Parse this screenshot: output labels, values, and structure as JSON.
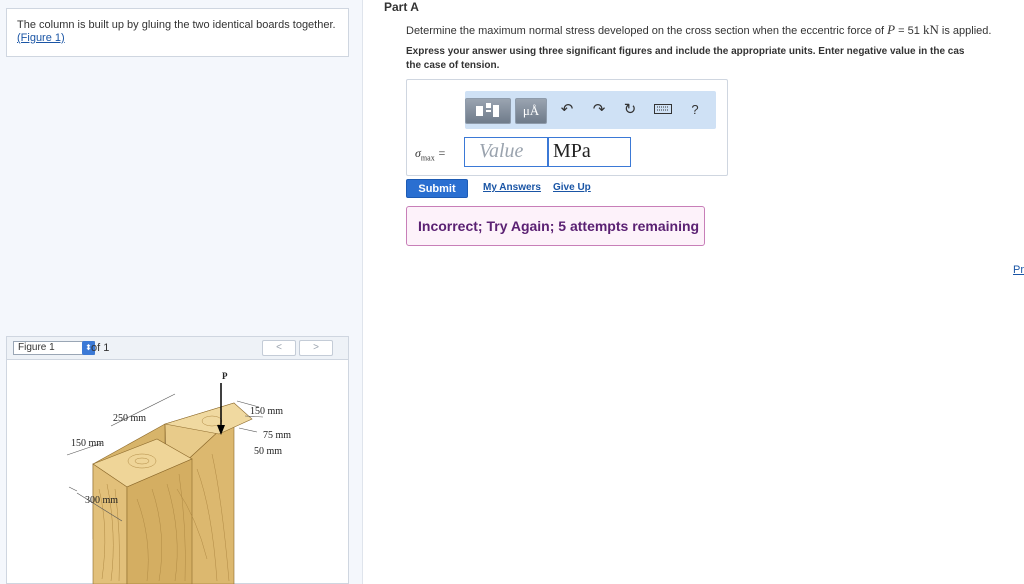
{
  "problem": {
    "text": "The column is built up by gluing the two identical boards together.",
    "figure_link": "(Figure 1)"
  },
  "figure_panel": {
    "selector_value": "Figure 1",
    "of_label": "of 1",
    "prev_icon": "chevron-left-icon",
    "next_icon": "chevron-right-icon",
    "labels": {
      "force": "P",
      "dim_250": "250 mm",
      "dim_150_left": "150 mm",
      "dim_300": "300 mm",
      "dim_150_right": "150 mm",
      "dim_75": "75 mm",
      "dim_50": "50 mm"
    }
  },
  "part": {
    "title": "Part A",
    "question_before": "Determine the maximum normal stress developed on the cross section when the eccentric force of ",
    "question_symbol": "P",
    "question_eq": " = 51 ",
    "question_unit": "kN",
    "question_after": " is applied.",
    "instruction_line1": "Express your answer using three significant figures and include the appropriate units. Enter negative value in the cas",
    "instruction_line2": "the case of tension."
  },
  "answer": {
    "symbol": "σ",
    "subscript": "max",
    "equals": " =",
    "value_placeholder": "Value",
    "unit_value": "MPa",
    "toolbar": {
      "template_icon": "template-icon",
      "units_label": "μÅ",
      "undo_icon": "undo-icon",
      "redo_icon": "redo-icon",
      "reset_icon": "reset-icon",
      "keyboard_icon": "keyboard-icon",
      "help_label": "?"
    }
  },
  "actions": {
    "submit": "Submit",
    "my_answers": "My Answers",
    "give_up": "Give Up"
  },
  "feedback": {
    "text": "Incorrect; Try Again; 5 attempts remaining"
  },
  "edge_link": "Pr",
  "colors": {
    "accent": "#2a6fd1",
    "feedback_border": "#c87fb8",
    "feedback_bg": "#fdf2fa",
    "feedback_text": "#5b2173",
    "wood": "#e2c07a"
  }
}
